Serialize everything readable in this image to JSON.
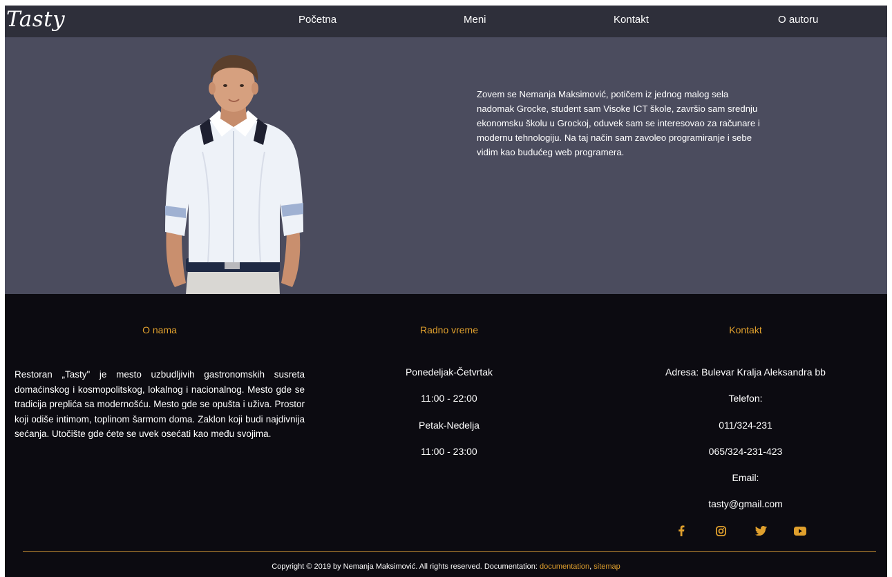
{
  "nav": {
    "logo": "Tasty",
    "links": [
      "Početna",
      "Meni",
      "Kontakt",
      "O autoru"
    ]
  },
  "hero": {
    "bio": "Zovem se Nemanja Maksimović, potičem iz jednog malog sela nadomak Grocke, student sam Visoke ICT škole, završio sam srednju ekonomsku školu u Grockoj, oduvek sam se interesovao za računare i modernu tehnologiju. Na taj način sam zavoleo programiranje i sebe vidim kao budućeg web programera."
  },
  "footer": {
    "about": {
      "title": "O nama",
      "text": "Restoran „Tasty\" je mesto uzbudljivih gastronomskih susreta domaćinskog i kosmopolitskog, lokalnog i nacionalnog. Mesto gde se tradicija preplića sa modernošću. Mesto gde se opušta i uživa. Prostor koji odiše intimom, toplinom šarmom doma. Zaklon koji budi najdivnija sećanja. Utočište gde ćete se uvek osećati kao među svojima."
    },
    "hours": {
      "title": "Radno vreme",
      "lines": [
        "Ponedeljak-Četvrtak",
        "11:00 - 22:00",
        "Petak-Nedelja",
        "11:00 - 23:00"
      ]
    },
    "contact": {
      "title": "Kontakt",
      "lines": [
        "Adresa: Bulevar Kralja Aleksandra bb",
        "Telefon:",
        "011/324-231",
        "065/324-231-423",
        "Email:",
        "tasty@gmail.com"
      ]
    },
    "social_icons": [
      "facebook-icon",
      "instagram-icon",
      "twitter-icon",
      "youtube-icon"
    ],
    "copyright": {
      "text": "Copyright © 2019 by Nemanja Maksimović. All rights reserved. Documentation: ",
      "link1": "documentation",
      "separator": ", ",
      "link2": "sitemap"
    }
  },
  "colors": {
    "nav_bg": "#2e2f3a",
    "hero_bg": "#4b4c5e",
    "footer_bg": "#0c0b11",
    "accent": "#e0a02d"
  }
}
